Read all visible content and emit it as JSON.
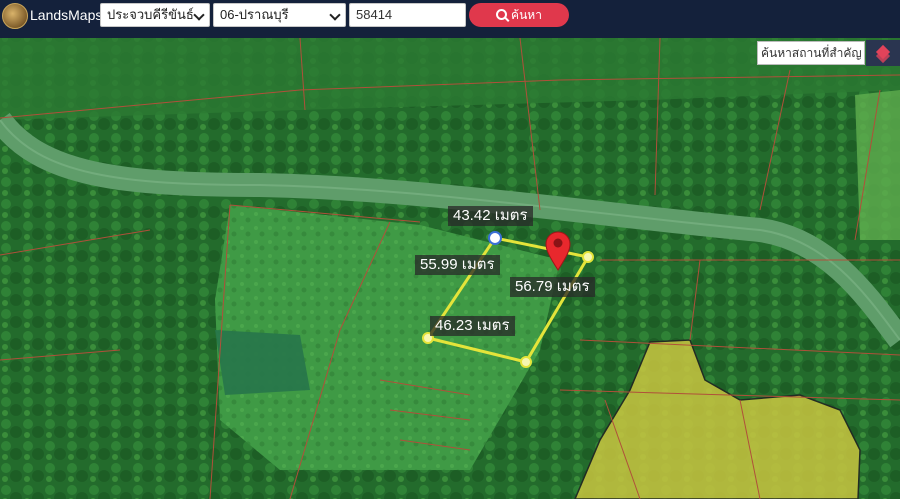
{
  "header": {
    "brand": "LandsMaps",
    "province_select": "ประจวบคีรีขันธ์",
    "amphur_select": "06-ปราณบุรี",
    "parcel_input": "58414",
    "search_label": "ค้นหา"
  },
  "map": {
    "poi_search_placeholder": "ค้นหาสถานที่สำคัญ",
    "measurements": [
      {
        "id": "top",
        "label": "43.42 เมตร"
      },
      {
        "id": "left",
        "label": "55.99 เมตร"
      },
      {
        "id": "right",
        "label": "56.79 เมตร"
      },
      {
        "id": "bottom",
        "label": "46.23 เมตร"
      }
    ]
  },
  "icons": {
    "logo": "seal-logo",
    "search": "magnifier-icon",
    "layers": "layers-icon",
    "marker": "map-pin-icon"
  },
  "colors": {
    "header_bg": "#14213b",
    "search_button": "#e0384c",
    "parcel_outline": "#e4e43a",
    "parcel_lines": "#b0503a",
    "zone_overlay": "#c9c640"
  }
}
